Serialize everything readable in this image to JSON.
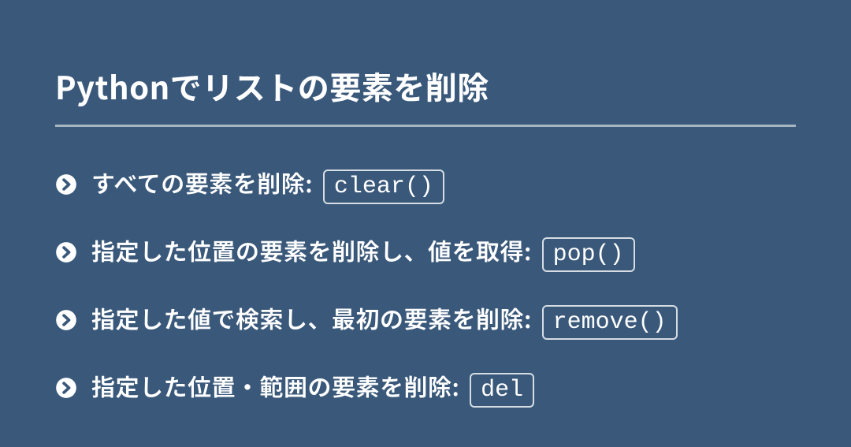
{
  "title": "Pythonでリストの要素を削除",
  "items": [
    {
      "text": "すべての要素を削除:",
      "code": "clear()"
    },
    {
      "text": "指定した位置の要素を削除し、値を取得:",
      "code": "pop()"
    },
    {
      "text": "指定した値で検索し、最初の要素を削除:",
      "code": "remove()"
    },
    {
      "text": "指定した位置・範囲の要素を削除:",
      "code": "del"
    }
  ]
}
